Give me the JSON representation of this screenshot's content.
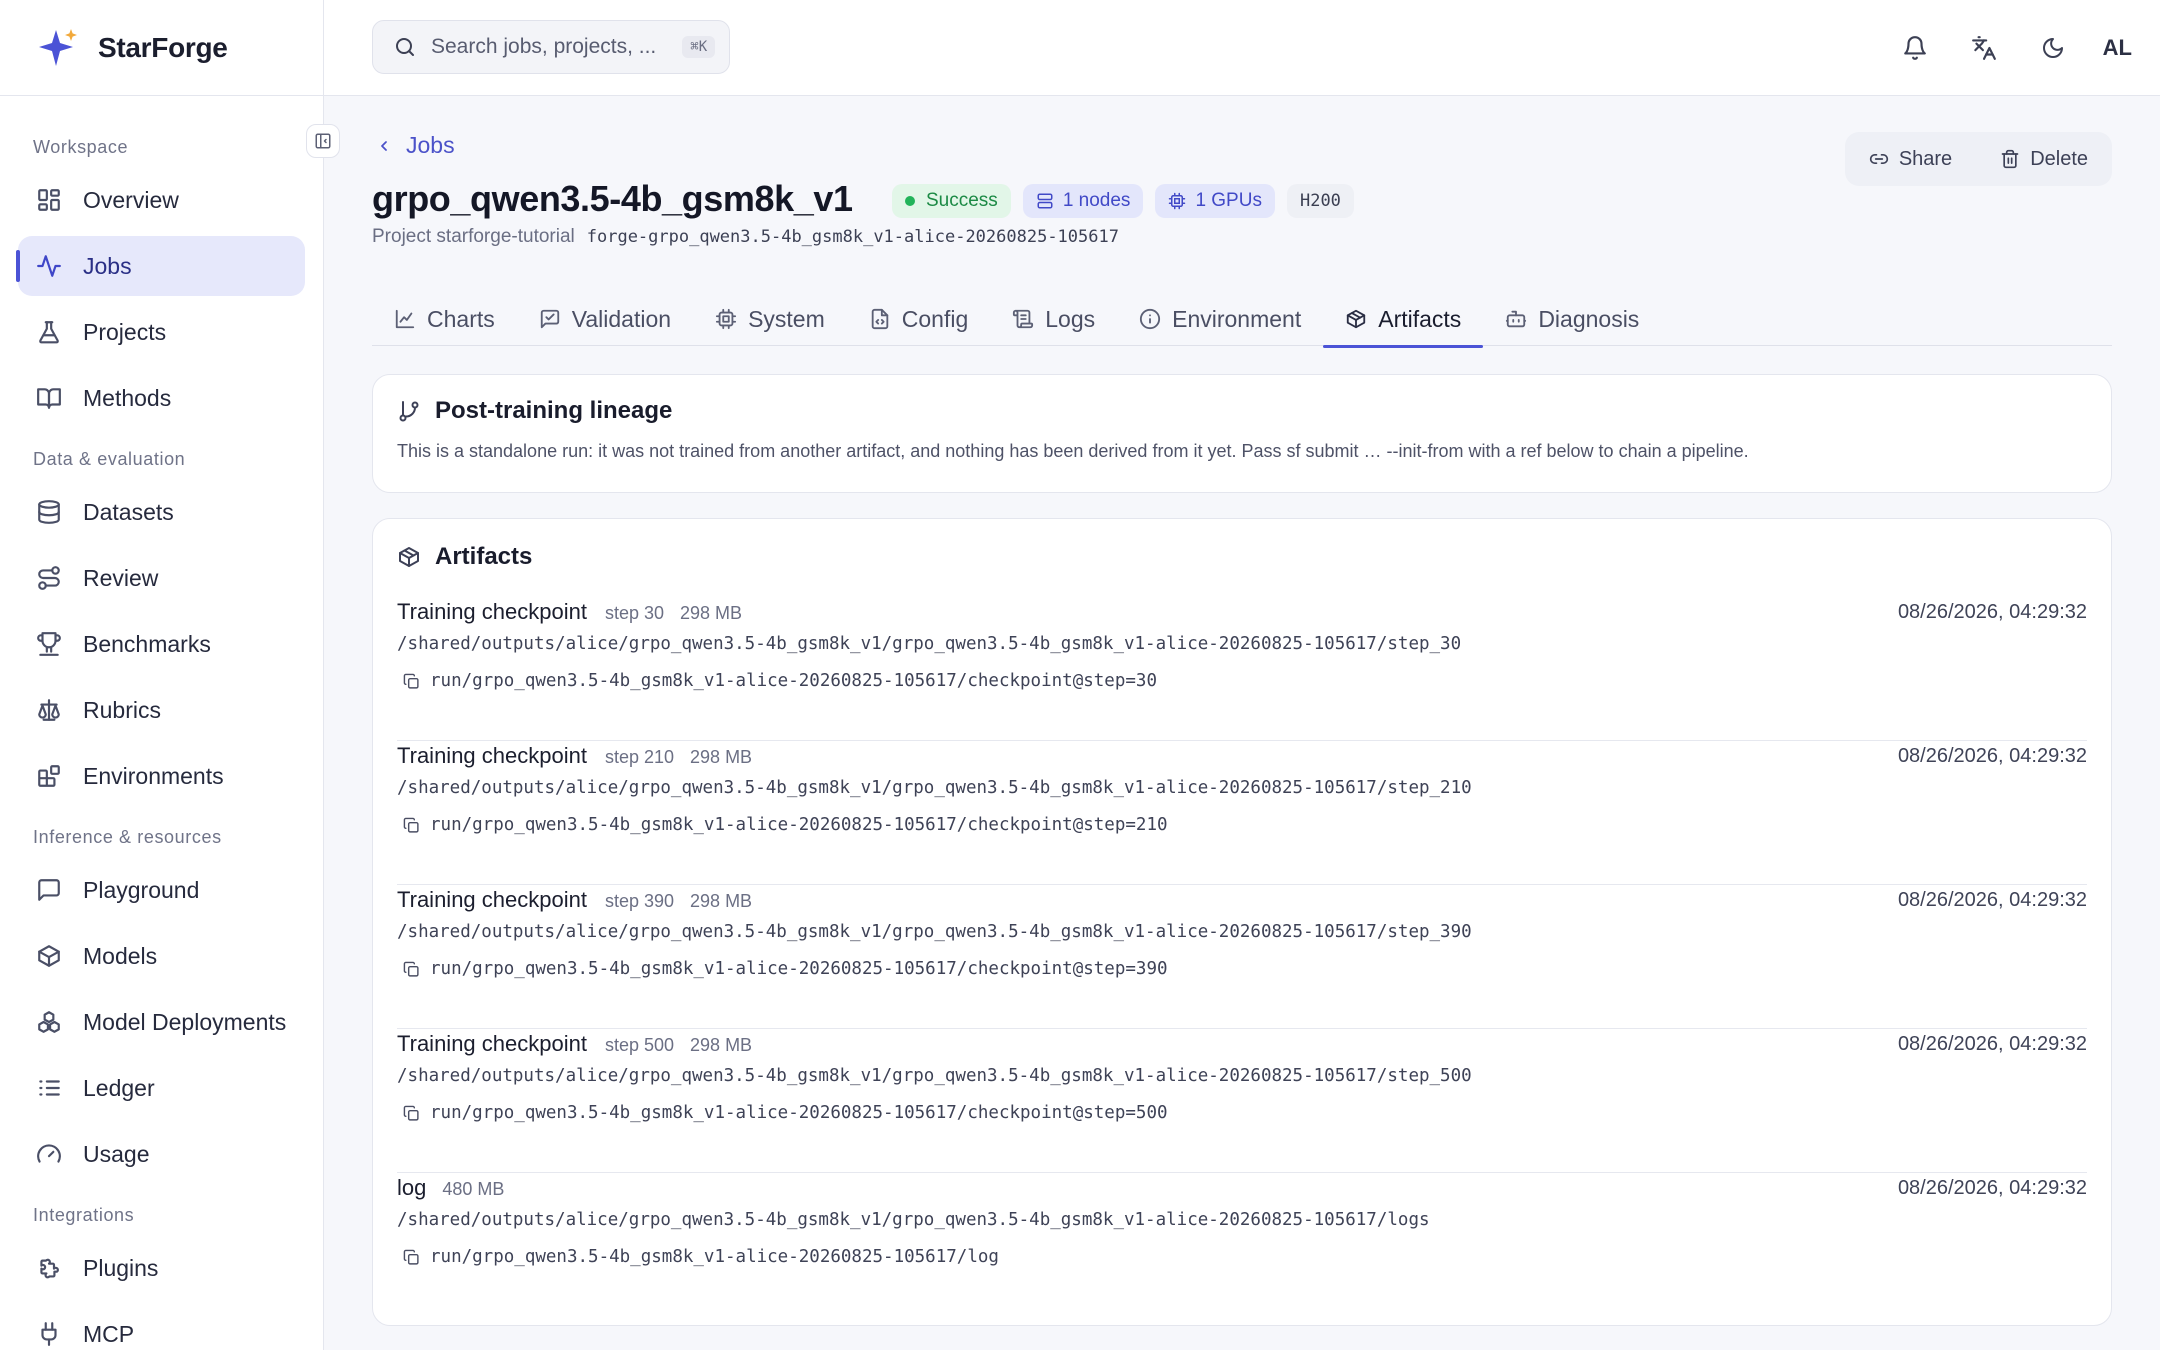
{
  "brand": {
    "name": "StarForge"
  },
  "sidebar": {
    "sections": [
      {
        "title": "Workspace",
        "items": [
          {
            "label": "Overview",
            "icon": "grid-icon"
          },
          {
            "label": "Jobs",
            "icon": "activity-icon",
            "active": true
          },
          {
            "label": "Projects",
            "icon": "flask-icon"
          },
          {
            "label": "Methods",
            "icon": "book-icon"
          }
        ]
      },
      {
        "title": "Data & evaluation",
        "items": [
          {
            "label": "Datasets",
            "icon": "database-icon"
          },
          {
            "label": "Review",
            "icon": "route-icon"
          },
          {
            "label": "Benchmarks",
            "icon": "trophy-icon"
          },
          {
            "label": "Rubrics",
            "icon": "scale-icon"
          },
          {
            "label": "Environments",
            "icon": "blocks-icon"
          }
        ]
      },
      {
        "title": "Inference & resources",
        "items": [
          {
            "label": "Playground",
            "icon": "message-icon"
          },
          {
            "label": "Models",
            "icon": "cube-icon"
          },
          {
            "label": "Model Deployments",
            "icon": "boxes-icon"
          },
          {
            "label": "Ledger",
            "icon": "list-icon"
          },
          {
            "label": "Usage",
            "icon": "gauge-icon"
          }
        ]
      },
      {
        "title": "Integrations",
        "items": [
          {
            "label": "Plugins",
            "icon": "puzzle-icon"
          },
          {
            "label": "MCP",
            "icon": "plug-icon"
          }
        ]
      }
    ]
  },
  "topbar": {
    "search_placeholder": "Search jobs, projects, ...",
    "search_shortcut": "⌘K",
    "avatar_initials": "AL"
  },
  "job": {
    "back_label": "Jobs",
    "title": "grpo_qwen3.5-4b_gsm8k_v1",
    "status": "Success",
    "nodes": "1 nodes",
    "gpus": "1 GPUs",
    "gpu_type": "H200",
    "project_label": "Project starforge-tutorial",
    "run_id": "forge-grpo_qwen3.5-4b_gsm8k_v1-alice-20260825-105617",
    "share_label": "Share",
    "delete_label": "Delete"
  },
  "tabs": [
    {
      "label": "Charts",
      "icon": "chart-icon"
    },
    {
      "label": "Validation",
      "icon": "chat-check-icon"
    },
    {
      "label": "System",
      "icon": "cpu-icon"
    },
    {
      "label": "Config",
      "icon": "file-code-icon"
    },
    {
      "label": "Logs",
      "icon": "scroll-icon"
    },
    {
      "label": "Environment",
      "icon": "info-icon"
    },
    {
      "label": "Artifacts",
      "icon": "package-icon",
      "active": true
    },
    {
      "label": "Diagnosis",
      "icon": "bot-icon"
    }
  ],
  "lineage": {
    "title": "Post-training lineage",
    "text": "This is a standalone run: it was not trained from another artifact, and nothing has been derived from it yet. Pass sf submit … --init-from with a ref below to chain a pipeline."
  },
  "artifacts": {
    "title": "Artifacts",
    "items": [
      {
        "name": "Training checkpoint",
        "step": "step 30",
        "size": "298 MB",
        "date": "08/26/2026, 04:29:32",
        "path": "/shared/outputs/alice/grpo_qwen3.5-4b_gsm8k_v1/grpo_qwen3.5-4b_gsm8k_v1-alice-20260825-105617/step_30",
        "ref": "run/grpo_qwen3.5-4b_gsm8k_v1-alice-20260825-105617/checkpoint@step=30"
      },
      {
        "name": "Training checkpoint",
        "step": "step 210",
        "size": "298 MB",
        "date": "08/26/2026, 04:29:32",
        "path": "/shared/outputs/alice/grpo_qwen3.5-4b_gsm8k_v1/grpo_qwen3.5-4b_gsm8k_v1-alice-20260825-105617/step_210",
        "ref": "run/grpo_qwen3.5-4b_gsm8k_v1-alice-20260825-105617/checkpoint@step=210"
      },
      {
        "name": "Training checkpoint",
        "step": "step 390",
        "size": "298 MB",
        "date": "08/26/2026, 04:29:32",
        "path": "/shared/outputs/alice/grpo_qwen3.5-4b_gsm8k_v1/grpo_qwen3.5-4b_gsm8k_v1-alice-20260825-105617/step_390",
        "ref": "run/grpo_qwen3.5-4b_gsm8k_v1-alice-20260825-105617/checkpoint@step=390"
      },
      {
        "name": "Training checkpoint",
        "step": "step 500",
        "size": "298 MB",
        "date": "08/26/2026, 04:29:32",
        "path": "/shared/outputs/alice/grpo_qwen3.5-4b_gsm8k_v1/grpo_qwen3.5-4b_gsm8k_v1-alice-20260825-105617/step_500",
        "ref": "run/grpo_qwen3.5-4b_gsm8k_v1-alice-20260825-105617/checkpoint@step=500"
      },
      {
        "name": "log",
        "step": "",
        "size": "480 MB",
        "date": "08/26/2026, 04:29:32",
        "path": "/shared/outputs/alice/grpo_qwen3.5-4b_gsm8k_v1/grpo_qwen3.5-4b_gsm8k_v1-alice-20260825-105617/logs",
        "ref": "run/grpo_qwen3.5-4b_gsm8k_v1-alice-20260825-105617/log"
      }
    ]
  }
}
